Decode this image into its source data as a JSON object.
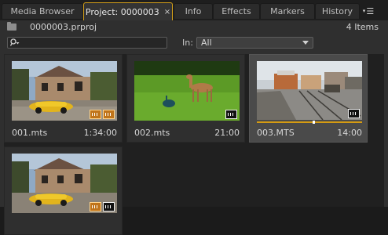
{
  "tabs": [
    {
      "label": "Media Browser",
      "active": false
    },
    {
      "label": "Project: 0000003",
      "active": true,
      "close": "×"
    },
    {
      "label": "Info",
      "active": false
    },
    {
      "label": "Effects",
      "active": false
    },
    {
      "label": "Markers",
      "active": false
    },
    {
      "label": "History",
      "active": false
    }
  ],
  "panel_menu_icon": "panel-menu-icon",
  "project": {
    "file_name": "0000003.prproj",
    "item_count": "4 Items"
  },
  "filter": {
    "search_value": "",
    "in_label": "In:",
    "in_value": "All"
  },
  "colors": {
    "accent": "#d59b12",
    "active_tab_border": "#d5a018",
    "selected_tile": "#4a4a4a"
  },
  "clips": [
    {
      "name": "001.mts",
      "duration": "1:34:00",
      "thumbnail": "yellow convertible in driveway",
      "badges": [
        "video-audio-icon",
        "audio-icon"
      ],
      "selected": false
    },
    {
      "name": "002.mts",
      "duration": "21:00",
      "thumbnail": "deer and peacock on lawn",
      "badges": [
        "audio-icon"
      ],
      "selected": false
    },
    {
      "name": "003.MTS",
      "duration": "14:00",
      "thumbnail": "railway station",
      "badges": [
        "audio-icon"
      ],
      "selected": true,
      "playhead_fraction": 0.53
    },
    {
      "name": "",
      "duration": "",
      "thumbnail": "yellow convertible in driveway",
      "badges": [
        "video-audio-icon",
        "audio-icon"
      ],
      "selected": false
    }
  ]
}
